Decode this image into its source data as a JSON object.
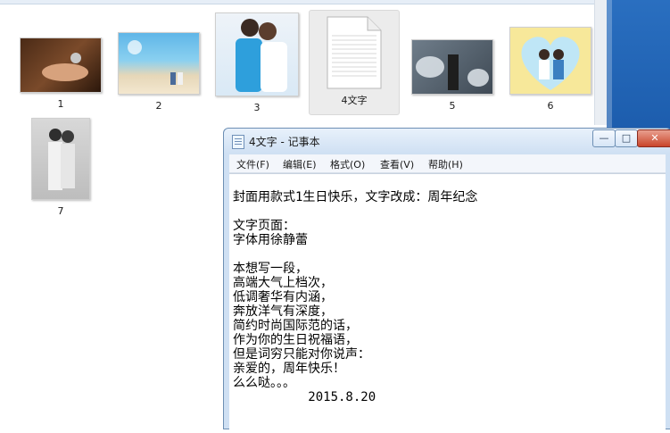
{
  "explorer": {
    "files": [
      {
        "label": "1",
        "kind": "photo"
      },
      {
        "label": "2",
        "kind": "photo"
      },
      {
        "label": "3",
        "kind": "photo"
      },
      {
        "label": "4文字",
        "kind": "text-file"
      },
      {
        "label": "5",
        "kind": "photo"
      },
      {
        "label": "6",
        "kind": "photo"
      },
      {
        "label": "7",
        "kind": "photo"
      }
    ]
  },
  "notepad": {
    "title": "4文字 - 记事本",
    "window_buttons": {
      "minimize": "—",
      "maximize": "□",
      "close": "✕"
    },
    "menu": [
      "文件(F)",
      "编辑(E)",
      "格式(O)",
      "查看(V)",
      "帮助(H)"
    ],
    "lines": [
      "封面用款式1生日快乐，文字改成：周年纪念",
      "",
      "文字页面：",
      "字体用徐静蕾",
      "",
      "本想写一段，",
      "高端大气上档次，",
      "低调奢华有内涵，",
      "奔放洋气有深度，",
      "简约时尚国际范的话，",
      "作为你的生日祝福语，",
      "但是词穷只能对你说声：",
      "亲爱的，周年快乐！",
      "么么哒。。。",
      "          2015.8.20"
    ]
  },
  "colors": {
    "titlebar": "#cfe0f3",
    "desktop": "#1857a7",
    "selection": "#ececec"
  }
}
